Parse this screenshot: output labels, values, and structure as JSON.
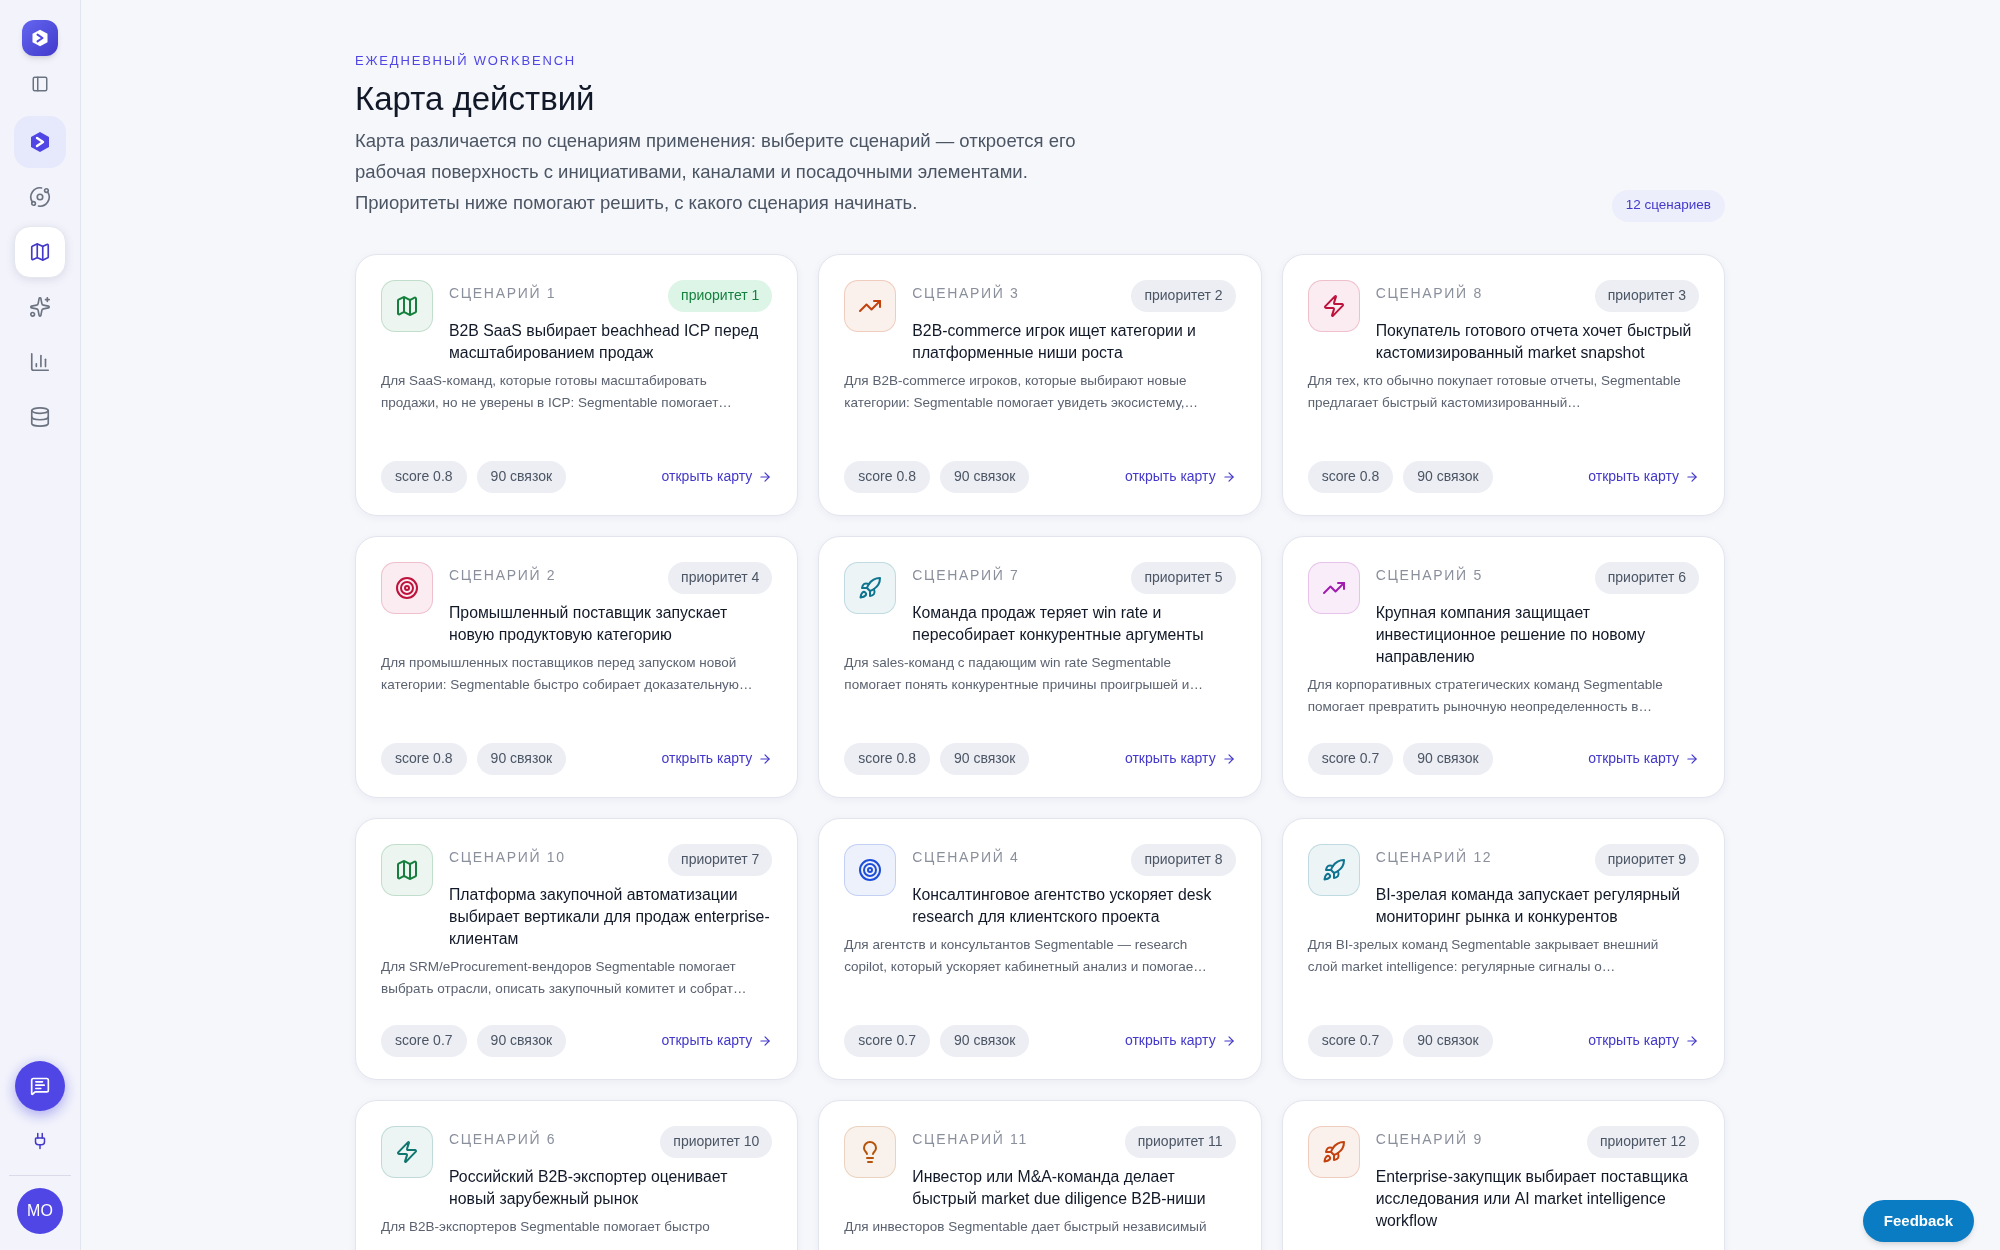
{
  "sidebar": {
    "top": [
      {
        "kind": "logo",
        "selected": false
      },
      {
        "kind": "panel-toggle",
        "selected": false
      }
    ],
    "nav": [
      {
        "kind": "product",
        "selected": false
      },
      {
        "kind": "orbit",
        "selected": false
      },
      {
        "kind": "map",
        "selected": true
      },
      {
        "kind": "sparkles",
        "selected": false
      },
      {
        "kind": "chart",
        "selected": false
      },
      {
        "kind": "database",
        "selected": false
      }
    ],
    "bottom": [
      {
        "kind": "chat"
      },
      {
        "kind": "plug"
      }
    ],
    "avatar": "MO"
  },
  "header": {
    "eyebrow": "ЕЖЕДНЕВНЫЙ WORKBENCH",
    "title": "Карта действий",
    "description": "Карта различается по сценариям применения: выберите сценарий — откроется его рабочая поверхность с инициативами, каналами и посадочными элементами. Приоритеты ниже помогают решить, с какого сценария начинать.",
    "count": "12 сценариев"
  },
  "cards": [
    {
      "kind": "map",
      "color": "#15803d",
      "scenario": "СЦЕНАРИЙ 1",
      "priority": "приоритет 1",
      "highlighted": true,
      "title": "B2B SaaS выбирает beachhead ICP перед масштабированием продаж",
      "description": "Для SaaS-команд, которые готовы масштабировать продажи, но не уверены в ICP: Segmentable помогает…",
      "score": "score 0.8",
      "links": "90 связок",
      "action": "открыть карту"
    },
    {
      "kind": "trend",
      "color": "#c2410c",
      "scenario": "СЦЕНАРИЙ 3",
      "priority": "приоритет 2",
      "highlighted": false,
      "title": "B2B-commerce игрок ищет категории и платформенные ниши роста",
      "description": "Для B2B-commerce игроков, которые выбирают новые категории: Segmentable помогает увидеть экосистему,…",
      "score": "score 0.8",
      "links": "90 связок",
      "action": "открыть карту"
    },
    {
      "kind": "bolt",
      "color": "#be123c",
      "scenario": "СЦЕНАРИЙ 8",
      "priority": "приоритет 3",
      "highlighted": false,
      "title": "Покупатель готового отчета хочет быстрый кастомизированный market snapshot",
      "description": "Для тех, кто обычно покупает готовые отчеты, Segmentable предлагает быстрый кастомизированный…",
      "score": "score 0.8",
      "links": "90 связок",
      "action": "открыть карту"
    },
    {
      "kind": "target",
      "color": "#be123c",
      "scenario": "СЦЕНАРИЙ 2",
      "priority": "приоритет 4",
      "highlighted": false,
      "title": "Промышленный поставщик запускает новую продуктовую категорию",
      "description": "Для промышленных поставщиков перед запуском новой категории: Segmentable быстро собирает доказательную…",
      "score": "score 0.8",
      "links": "90 связок",
      "action": "открыть карту"
    },
    {
      "kind": "rocket",
      "color": "#0e7490",
      "scenario": "СЦЕНАРИЙ 7",
      "priority": "приоритет 5",
      "highlighted": false,
      "title": "Команда продаж теряет win rate и пересобирает конкурентные аргументы",
      "description": "Для sales-команд с падающим win rate Segmentable помогает понять конкурентные причины проигрышей и…",
      "score": "score 0.8",
      "links": "90 связок",
      "action": "открыть карту"
    },
    {
      "kind": "trend",
      "color": "#a21caf",
      "scenario": "СЦЕНАРИЙ 5",
      "priority": "приоритет 6",
      "highlighted": false,
      "title": "Крупная компания защищает инвестиционное решение по новому направлению",
      "description": "Для корпоративных стратегических команд Segmentable помогает превратить рыночную неопределенность в…",
      "score": "score 0.7",
      "links": "90 связок",
      "action": "открыть карту"
    },
    {
      "kind": "map",
      "color": "#15803d",
      "scenario": "СЦЕНАРИЙ 10",
      "priority": "приоритет 7",
      "highlighted": false,
      "title": "Платформа закупочной автоматизации выбирает вертикали для продаж enterprise-клиентам",
      "description": "Для SRM/eProcurement-вендоров Segmentable помогает выбрать отрасли, описать закупочный комитет и собрат…",
      "score": "score 0.7",
      "links": "90 связок",
      "action": "открыть карту"
    },
    {
      "kind": "target",
      "color": "#1d4ed8",
      "scenario": "СЦЕНАРИЙ 4",
      "priority": "приоритет 8",
      "highlighted": false,
      "title": "Консалтинговое агентство ускоряет desk research для клиентского проекта",
      "description": "Для агентств и консультантов Segmentable — research copilot, который ускоряет кабинетный анализ и помогае…",
      "score": "score 0.7",
      "links": "90 связок",
      "action": "открыть карту"
    },
    {
      "kind": "rocket",
      "color": "#0e7490",
      "scenario": "СЦЕНАРИЙ 12",
      "priority": "приоритет 9",
      "highlighted": false,
      "title": "BI-зрелая команда запускает регулярный мониторинг рынка и конкурентов",
      "description": "Для BI-зрелых команд Segmentable закрывает внешний слой market intelligence: регулярные сигналы о…",
      "score": "score 0.7",
      "links": "90 связок",
      "action": "открыть карту"
    },
    {
      "kind": "bolt",
      "color": "#0f766e",
      "scenario": "СЦЕНАРИЙ 6",
      "priority": "приоритет 10",
      "highlighted": false,
      "title": "Российский B2B-экспортер оценивает новый зарубежный рынок",
      "description": "Для B2B-экспортеров Segmentable помогает быстро"
    },
    {
      "kind": "bulb",
      "color": "#b45309",
      "scenario": "СЦЕНАРИЙ 11",
      "priority": "приоритет 11",
      "highlighted": false,
      "title": "Инвестор или M&A-команда делает быстрый market due diligence B2B-ниши",
      "description": "Для инвесторов Segmentable дает быстрый независимый"
    },
    {
      "kind": "rocket",
      "color": "#c2410c",
      "scenario": "СЦЕНАРИЙ 9",
      "priority": "приоритет 12",
      "highlighted": false,
      "title": "Enterprise-закупщик выбирает поставщика исследования или AI market intelligence workflow"
    }
  ],
  "feedback": "Feedback"
}
